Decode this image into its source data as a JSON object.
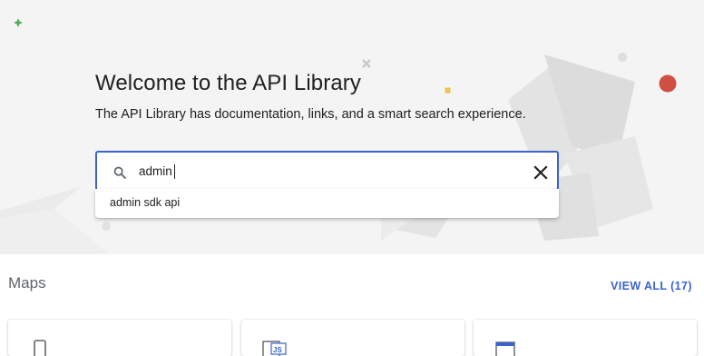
{
  "hero": {
    "title": "Welcome to the API Library",
    "subtitle": "The API Library has documentation, links, and a smart search experience."
  },
  "search": {
    "value": "admin",
    "icon": "search-icon",
    "clear_icon": "close-icon",
    "suggestions": [
      "admin sdk api"
    ]
  },
  "section": {
    "title": "Maps",
    "view_all_label": "VIEW ALL (17)"
  },
  "cards": [
    {
      "icon": "phone-icon"
    },
    {
      "icon": "js-api-icon"
    },
    {
      "icon": "browser-icon"
    }
  ],
  "colors": {
    "accent": "#3b63cc",
    "hero_bg": "#f4f4f4",
    "text": "#202124",
    "muted": "#5f6368",
    "deco_red": "#cf4f42"
  }
}
